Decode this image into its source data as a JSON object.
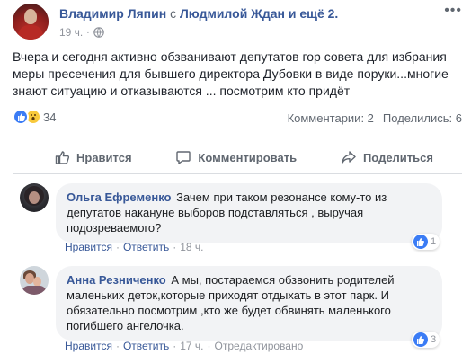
{
  "post": {
    "author": "Владимир Ляпин",
    "with_text": "с",
    "tagged": "Людмилой Ждан и ещё 2.",
    "time": "19 ч.",
    "meta_sep": "·",
    "options_icon": "more-horizontal-icon",
    "text": "Вчера и сегодня активно обзванивают депутатов гор совета для избрания меры пресечения для бывшего директора Дубовки в виде поруки...многие знают ситуацию и отказываются ... посмотрим кто придёт"
  },
  "reactions": {
    "icons": [
      "like-icon",
      "wow-icon"
    ],
    "count": "34",
    "comments": "Комментарии: 2",
    "shares": "Поделились: 6"
  },
  "actions": {
    "like": "Нравится",
    "comment": "Комментировать",
    "share": "Поделиться"
  },
  "comments": [
    {
      "author": "Ольга Ефременко",
      "text": "Зачем при таком резонансе кому-то из депутатов накануне выборов подставляться , выручая подозреваемого?",
      "like": "Нравится",
      "reply": "Ответить",
      "time": "18 ч.",
      "likes": "1",
      "edited": ""
    },
    {
      "author": "Анна Резниченко",
      "text": "А мы, постараемся обзвонить родителей маленьких деток,которые приходят отдыхать в этот парк. И обязательно посмотрим ,кто же будет обвинять маленького погибшего ангелочка.",
      "like": "Нравится",
      "reply": "Ответить",
      "time": "17 ч.",
      "likes": "3",
      "edited": "Отредактировано"
    }
  ],
  "colors": {
    "link": "#385898",
    "muted": "#90949c",
    "bubble": "#f2f3f5",
    "like_blue": "#3b7cf5"
  }
}
